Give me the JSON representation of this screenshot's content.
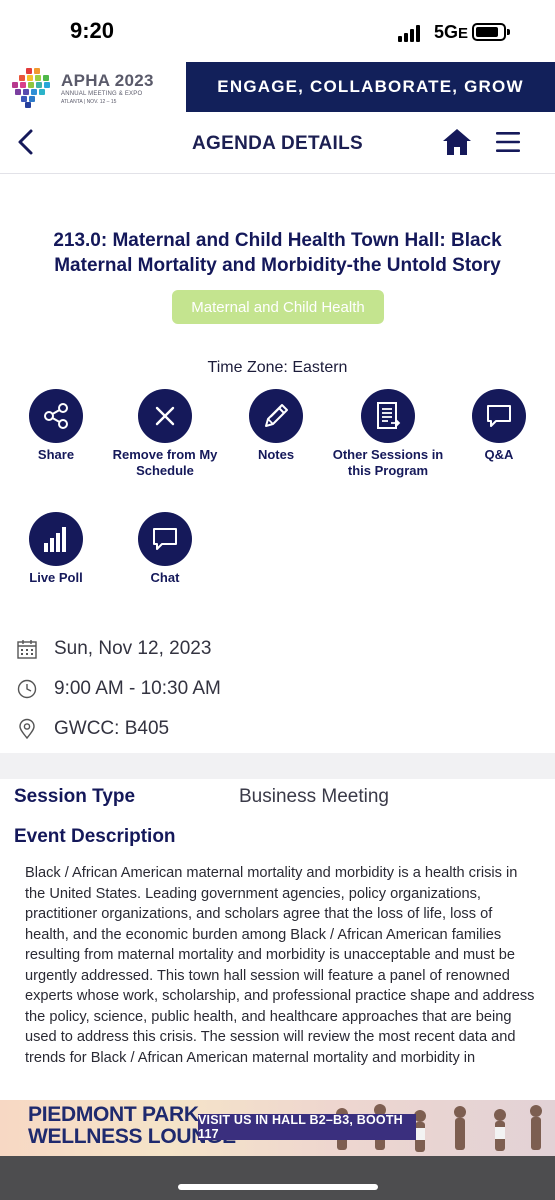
{
  "status_bar": {
    "time": "9:20",
    "network": "5G",
    "network_suffix": "E"
  },
  "brand": {
    "name": "APHA 2023",
    "subtitle": "ANNUAL MEETING & EXPO",
    "location": "ATLANTA | NOV. 12 – 15",
    "tagline": "ENGAGE, COLLABORATE, GROW"
  },
  "header": {
    "title": "AGENDA DETAILS"
  },
  "session": {
    "title": "213.0: Maternal and Child Health Town Hall: Black Maternal Mortality and Morbidity-the Untold Story",
    "track": "Maternal and Child Health",
    "track_color": "#c4e48f",
    "timezone": "Time Zone: Eastern"
  },
  "actions": [
    {
      "label": "Share",
      "icon": "share-icon"
    },
    {
      "label": "Remove from My Schedule",
      "icon": "close-icon"
    },
    {
      "label": "Notes",
      "icon": "pencil-icon"
    },
    {
      "label": "Other Sessions in this Program",
      "icon": "document-list-icon"
    },
    {
      "label": "Q&A",
      "icon": "speech-bubble-icon"
    },
    {
      "label": "Live Poll",
      "icon": "bar-chart-icon"
    },
    {
      "label": "Chat",
      "icon": "chat-icon"
    }
  ],
  "details": {
    "date": "Sun, Nov 12, 2023",
    "time": "9:00 AM - 10:30 AM",
    "location": "GWCC: B405"
  },
  "info": {
    "session_type_label": "Session Type",
    "session_type_value": "Business Meeting",
    "description_label": "Event Description",
    "description": "Black / African American maternal mortality and morbidity is a health crisis in the United States. Leading government agencies, policy organizations, practitioner organizations, and scholars agree that the loss of life, loss of health, and the economic burden among Black / African American families resulting from maternal mortality and morbidity is unacceptable and must be urgently addressed. This town hall session will feature a panel of renowned experts whose work, scholarship, and professional practice shape and address the policy, science, public health, and healthcare approaches that are being used to address this crisis. The session will review the most recent data and trends for Black / African American maternal mortality and morbidity in"
  },
  "ad": {
    "line1": "PIEDMONT PARK",
    "line2": "WELLNESS LOUNGE",
    "cta": "VISIT US IN HALL B2–B3, BOOTH 117"
  },
  "colors": {
    "navy": "#15195a",
    "banner": "#12205a"
  }
}
